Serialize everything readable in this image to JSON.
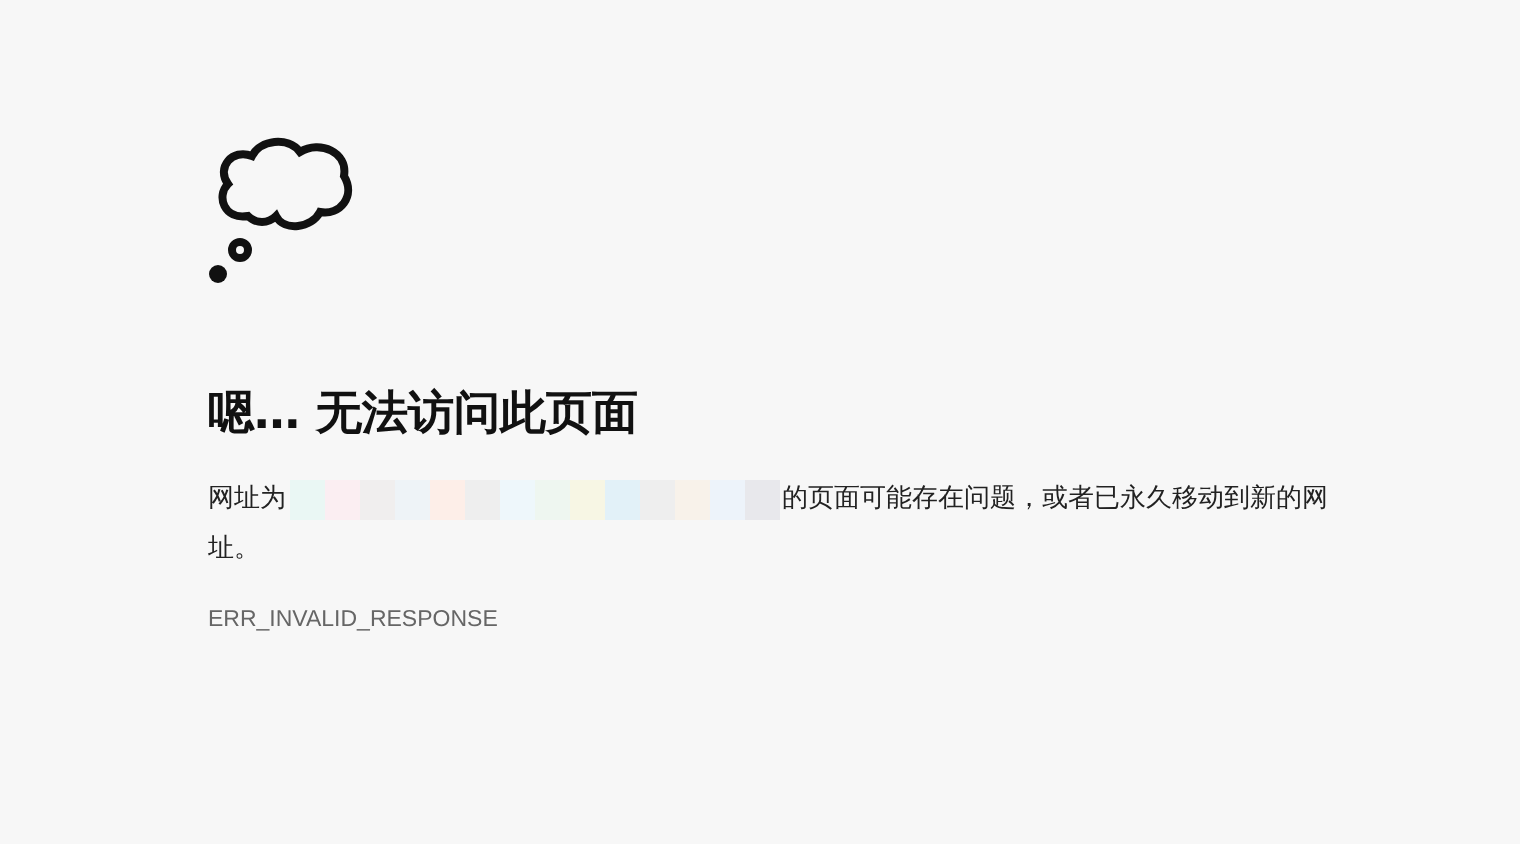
{
  "error_page": {
    "title": "嗯… 无法访问此页面",
    "message_before": "网址为",
    "message_after_lines": [
      "的页面可能存在问题，或者已永久移动到新的网",
      "址。"
    ],
    "error_code": "ERR_INVALID_RESPONSE"
  }
}
